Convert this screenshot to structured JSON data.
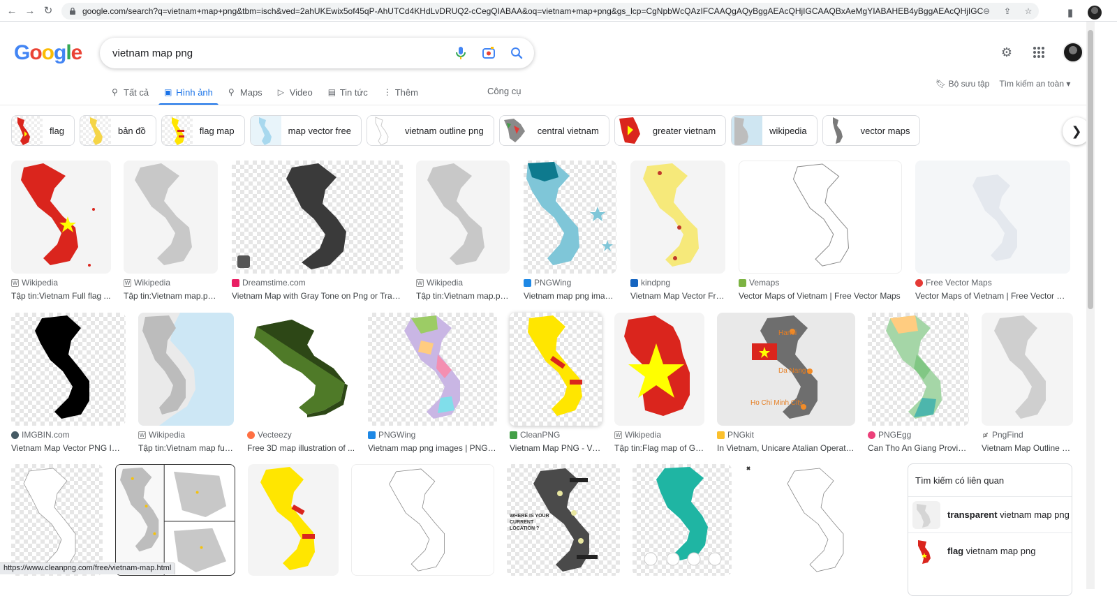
{
  "browser": {
    "url": "google.com/search?q=vietnam+map+png&tbm=isch&ved=2ahUKEwix5of45qP-AhUTCd4KHdLvDRUQ2-cCegQIABAA&oq=vietnam+map+png&gs_lcp=CgNpbWcQAzIFCAAQgAQyBggAEAcQHjIGCAAQBxAeMgYIABAHEB4yBggAEAcQHjIGCAAQBxAeMg..."
  },
  "logo": "Google",
  "search": {
    "query": "vietnam map png"
  },
  "tabs": [
    {
      "label": "Tất cả",
      "icon": "search-icon"
    },
    {
      "label": "Hình ảnh",
      "icon": "image-icon",
      "active": true
    },
    {
      "label": "Maps",
      "icon": "pin-icon"
    },
    {
      "label": "Video",
      "icon": "video-icon"
    },
    {
      "label": "Tin tức",
      "icon": "news-icon"
    },
    {
      "label": "Thêm",
      "icon": "more-icon"
    }
  ],
  "tools_label": "Công cụ",
  "saved_label": "Bộ sưu tập",
  "safe_search_label": "Tìm kiếm an toàn",
  "chips": [
    "flag",
    "bản đồ",
    "flag map",
    "map vector free",
    "vietnam outline png",
    "central vietnam",
    "greater vietnam",
    "wikipedia",
    "vector maps"
  ],
  "results": [
    {
      "source": "Wikipedia",
      "title": "Tập tin:Vietnam Full flag ..."
    },
    {
      "source": "Wikipedia",
      "title": "Tập tin:Vietnam map.pn..."
    },
    {
      "source": "Dreamstime.com",
      "title": "Vietnam Map with Gray Tone on Png or Transp..."
    },
    {
      "source": "Wikipedia",
      "title": "Tập tin:Vietnam map.pn..."
    },
    {
      "source": "PNGWing",
      "title": "Vietnam map png imag..."
    },
    {
      "source": "kindpng",
      "title": "Vietnam Map Vector Fre..."
    },
    {
      "source": "Vemaps",
      "title": "Vector Maps of Vietnam | Free Vector Maps"
    },
    {
      "source": "Free Vector Maps",
      "title": "Vector Maps of Vietnam | Free Vector Maps"
    },
    {
      "source": "IMGBIN.com",
      "title": "Vietnam Map Vector PNG Ima..."
    },
    {
      "source": "Wikipedia",
      "title": "Tập tin:Vietnam map full..."
    },
    {
      "source": "Vecteezy",
      "title": "Free 3D map illustration of ..."
    },
    {
      "source": "PNGWing",
      "title": "Vietnam map png images | PNGWi..."
    },
    {
      "source": "CleanPNG",
      "title": "Vietnam Map PNG - Vie..."
    },
    {
      "source": "Wikipedia",
      "title": "Tập tin:Flag map of Gr..."
    },
    {
      "source": "PNGkit",
      "title": "In Vietnam, Unicare Atalian Operates..."
    },
    {
      "source": "PNGEgg",
      "title": "Can Tho An Giang Provinc..."
    },
    {
      "source": "PngFind",
      "title": "Vietnam Map Outline P..."
    }
  ],
  "map_labels": {
    "hanoi": "Hanoi",
    "danang": "Da Nang",
    "hcm": "Ho Chi Minh City"
  },
  "related": {
    "heading": "Tìm kiếm có liên quan",
    "items": [
      {
        "bold": "transparent",
        "rest": " vietnam map png"
      },
      {
        "bold": "flag",
        "rest": " vietnam map png"
      }
    ]
  },
  "status_url": "https://www.cleanpng.com/free/vietnam-map.html",
  "colors": {
    "accent": "#1a73e8",
    "vn_red": "#da251d",
    "vn_yellow": "#ffff00"
  }
}
